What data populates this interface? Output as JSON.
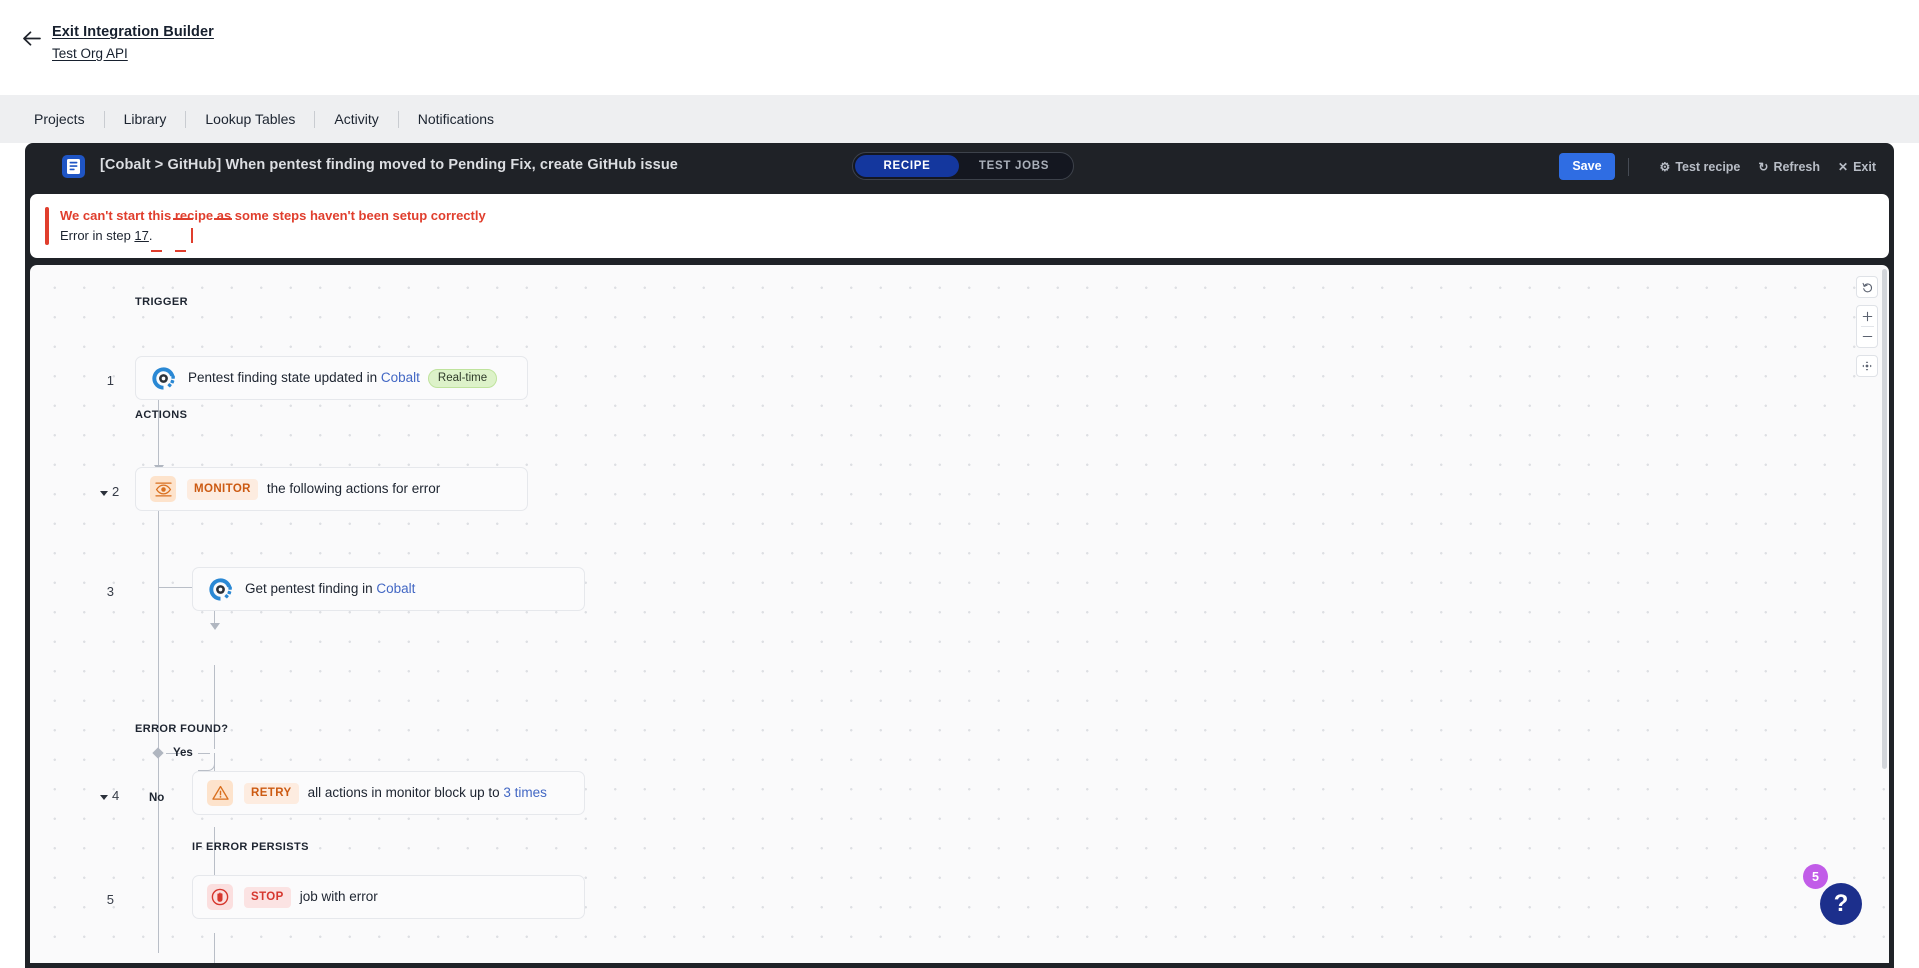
{
  "topbar": {
    "back_icon": "arrow-left-icon",
    "exit_label": "Exit Integration Builder",
    "org_label": "Test Org API"
  },
  "nav": {
    "items": [
      {
        "label": "Projects"
      },
      {
        "label": "Library"
      },
      {
        "label": "Lookup Tables"
      },
      {
        "label": "Activity"
      },
      {
        "label": "Notifications"
      }
    ]
  },
  "recipe_header": {
    "icon": "recipe-document-icon",
    "title": "[Cobalt > GitHub] When pentest finding moved to Pending Fix, create GitHub issue",
    "tabs": [
      {
        "label": "RECIPE",
        "active": true
      },
      {
        "label": "TEST JOBS",
        "active": false
      }
    ],
    "save_label": "Save",
    "test_recipe_label": "Test recipe",
    "test_recipe_icon": "gear-icon",
    "refresh_label": "Refresh",
    "refresh_icon": "refresh-icon",
    "exit_label": "Exit",
    "exit_icon": "close-icon",
    "accent_blue": "#2f6de3",
    "tab_active_blue": "#14379e"
  },
  "error_banner": {
    "headline": "We can't start this recipe as some steps haven't been setup correctly",
    "detail_prefix": "Error in step ",
    "detail_step": "17",
    "detail_suffix": ".",
    "accent_color": "#e03e2d"
  },
  "canvas": {
    "sections": {
      "trigger": "TRIGGER",
      "actions": "ACTIONS",
      "error_found": "ERROR FOUND?",
      "if_error_persists": "IF ERROR PERSISTS"
    },
    "branches": {
      "yes": "Yes",
      "no": "No"
    },
    "steps": [
      {
        "number": "1",
        "icon": "cobalt-app-icon",
        "text_before": "Pentest finding state updated in ",
        "link": "Cobalt",
        "text_after": "",
        "pill": "Real-time",
        "collapsible": false
      },
      {
        "number": "2",
        "icon": "monitor-eye-icon",
        "keyword": "MONITOR",
        "keyword_style": "orange",
        "text_before": "the following actions for error",
        "collapsible": true
      },
      {
        "number": "3",
        "icon": "cobalt-app-icon",
        "text_before": "Get pentest finding in ",
        "link": "Cobalt",
        "text_after": "",
        "collapsible": false
      },
      {
        "number": "4",
        "icon": "warning-triangle-icon",
        "keyword": "RETRY",
        "keyword_style": "orange",
        "text_before": "all actions in monitor block up to ",
        "link": "3 times",
        "text_after": "",
        "collapsible": true
      },
      {
        "number": "5",
        "icon": "stop-hand-icon",
        "keyword": "STOP",
        "keyword_style": "red",
        "text_before": "job with error",
        "collapsible": false
      }
    ],
    "controls": [
      {
        "icon": "undo-icon",
        "name": "undo-button"
      },
      {
        "icon": "zoom-in-icon",
        "name": "zoom-in-button"
      },
      {
        "icon": "zoom-out-icon",
        "name": "zoom-out-button"
      },
      {
        "icon": "fit-to-screen-icon",
        "name": "fit-screen-button"
      }
    ]
  },
  "help": {
    "icon": "question-mark-icon",
    "badge_count": "5",
    "badge_color": "#c15ce8",
    "fab_color": "#1c2f8c"
  }
}
